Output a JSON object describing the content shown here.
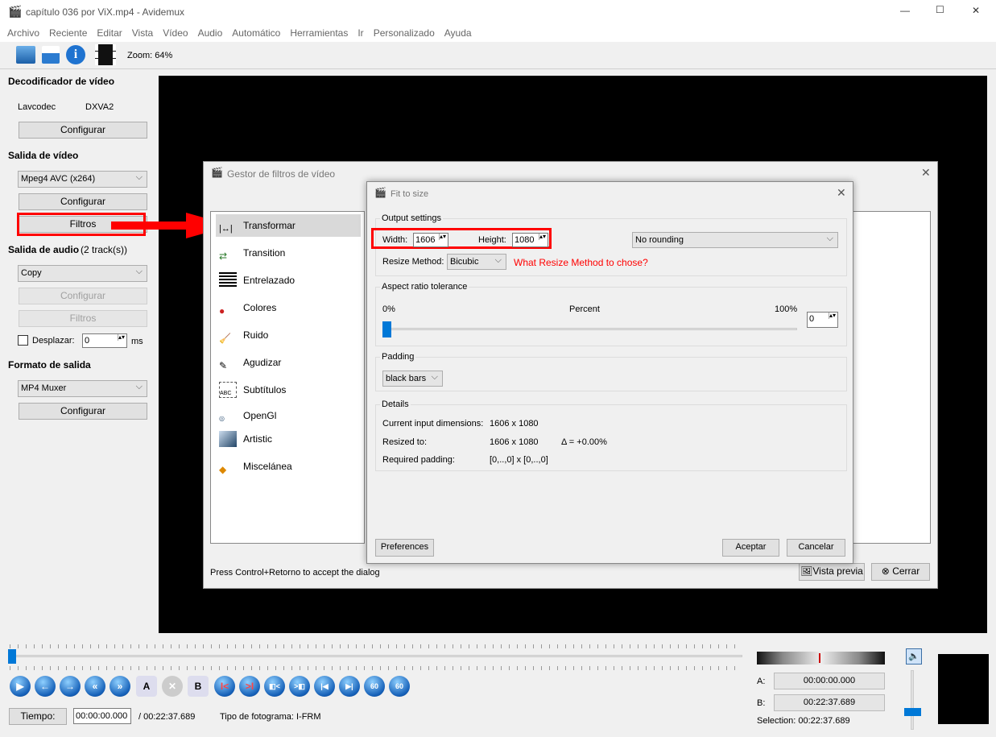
{
  "window": {
    "title": "capítulo 036 por ViX.mp4 - Avidemux",
    "min": "—",
    "max": "☐",
    "close": "✕"
  },
  "menu": [
    "Archivo",
    "Reciente",
    "Editar",
    "Vista",
    "Vídeo",
    "Audio",
    "Automático",
    "Herramientas",
    "Ir",
    "Personalizado",
    "Ayuda"
  ],
  "toolbar": {
    "zoom": "Zoom: 64%",
    "icons": [
      "open-icon",
      "save-icon",
      "info-icon",
      "filter-icon"
    ]
  },
  "left": {
    "video_decoder": "Decodificador de vídeo",
    "decoder": "Lavcodec",
    "accel": "DXVA2",
    "configure": "Configurar",
    "video_output": "Salida de vídeo",
    "video_codec": "Mpeg4 AVC (x264)",
    "filters": "Filtros",
    "audio_output": "Salida de audio",
    "audio_tracks": "(2 track(s))",
    "audio_codec": "Copy",
    "shift": "Desplazar:",
    "shift_value": "0",
    "ms": "ms",
    "output_format": "Formato de salida",
    "muxer": "MP4 Muxer"
  },
  "filter_manager": {
    "title": "Gestor de filtros de vídeo",
    "categories": [
      "Transformar",
      "Transition",
      "Entrelazado",
      "Colores",
      "Ruido",
      "Agudizar",
      "Subtítulos",
      "OpenGl",
      "Artistic",
      "Miscelánea"
    ],
    "hint": "Press Control+Retorno to accept the dialog",
    "preview": "Vista previa",
    "close": "Cerrar"
  },
  "fit": {
    "title": "Fit to size",
    "output_settings": "Output settings",
    "width_label": "Width:",
    "width": "1606",
    "height_label": "Height:",
    "height": "1080",
    "rounding": "No rounding",
    "resize_label": "Resize Method:",
    "resize": "Bicubic",
    "question": "What Resize Method to chose?",
    "aspect": "Aspect ratio tolerance",
    "min": "0%",
    "unit": "Percent",
    "max": "100%",
    "tolerance": "0",
    "tolerance_fraction": 0,
    "padding": "Padding",
    "padding_value": "black bars",
    "details": "Details",
    "cur_label": "Current input dimensions:",
    "cur": "1606 x 1080",
    "resized_label": "Resized to:",
    "resized": "1606 x 1080",
    "delta": "Δ = +0.00%",
    "pad_label": "Required padding:",
    "pad": "[0,..,0] x [0,..,0]",
    "preferences": "Preferences",
    "accept": "Aceptar",
    "cancel": "Cancelar"
  },
  "bottom": {
    "time_btn": "Tiempo:",
    "time": "00:00:00.000",
    "total": "/ 00:22:37.689",
    "frame_type": "Tipo de fotograma:  I-FRM",
    "a_label": "A:",
    "a": "00:00:00.000",
    "b_label": "B:",
    "b": "00:22:37.689",
    "selection": "Selection: 00:22:37.689",
    "buttons": [
      "▶",
      "←",
      "→",
      "«",
      "»",
      "A",
      "✕",
      "B",
      "I<",
      ">I",
      "◧<",
      ">◧",
      "|◀",
      "▶|",
      "60",
      "60"
    ]
  },
  "colors": {
    "accent": "#0078d7",
    "annotation": "#ff0000"
  }
}
